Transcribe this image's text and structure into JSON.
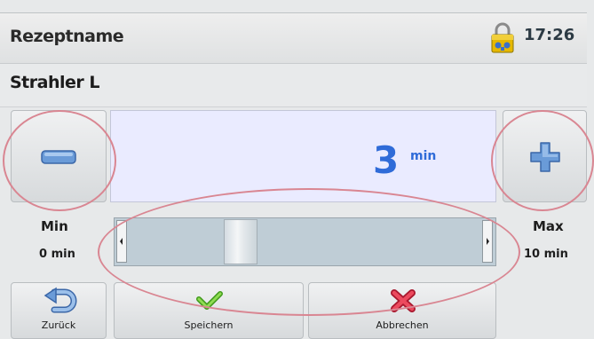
{
  "header": {
    "title": "Rezeptname",
    "time": "17:26"
  },
  "recipe": {
    "item_name": "Strahler L"
  },
  "duration": {
    "value": "3",
    "unit": "min"
  },
  "limits": {
    "min_label": "Min",
    "min_value": "0 min",
    "max_label": "Max",
    "max_value": "10 min"
  },
  "slider": {
    "level": 0.3
  },
  "footer": {
    "back": "Zurück",
    "save": "Speichern",
    "cancel": "Abbrechen"
  },
  "colors": {
    "accent": "#2f6bd8",
    "confirm": "#5fbf2a",
    "cancel": "#d8304a",
    "highlight": "#d98692"
  }
}
